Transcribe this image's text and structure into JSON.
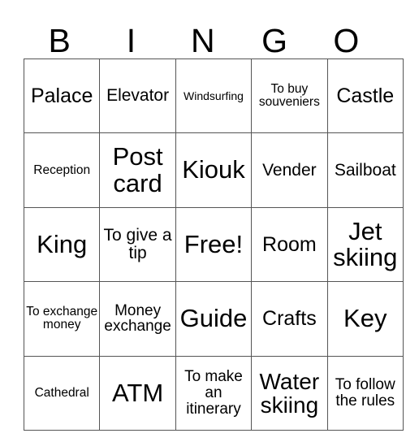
{
  "card": {
    "title_letters": [
      "B",
      "I",
      "N",
      "G",
      "O"
    ],
    "free_space_label": "Free!",
    "colors": {
      "background": "#ffffff",
      "text": "#000000",
      "grid_line": "#555555"
    },
    "rows": [
      [
        {
          "label": "Palace",
          "size": "fs-lg"
        },
        {
          "label": "Elevator",
          "size": "fs-md"
        },
        {
          "label": "Windsurfing",
          "size": "fs-xxs"
        },
        {
          "label": "To buy souveniers",
          "size": "fs-xs"
        },
        {
          "label": "Castle",
          "size": "fs-lg"
        }
      ],
      [
        {
          "label": "Reception",
          "size": "fs-xs"
        },
        {
          "label": "Post card",
          "size": "fs-xxl"
        },
        {
          "label": "Kiouk",
          "size": "fs-xxl"
        },
        {
          "label": "Vender",
          "size": "fs-md"
        },
        {
          "label": "Sailboat",
          "size": "fs-md"
        }
      ],
      [
        {
          "label": "King",
          "size": "fs-xxl"
        },
        {
          "label": "To give a tip",
          "size": "fs-md"
        },
        {
          "label": "Free!",
          "size": "fs-xxl"
        },
        {
          "label": "Room",
          "size": "fs-lg"
        },
        {
          "label": "Jet skiing",
          "size": "fs-xxl"
        }
      ],
      [
        {
          "label": "To exchange money",
          "size": "fs-xs"
        },
        {
          "label": "Money exchange",
          "size": "fs-sm"
        },
        {
          "label": "Guide",
          "size": "fs-xxl"
        },
        {
          "label": "Crafts",
          "size": "fs-lg"
        },
        {
          "label": "Key",
          "size": "fs-xxl"
        }
      ],
      [
        {
          "label": "Cathedral",
          "size": "fs-xs"
        },
        {
          "label": "ATM",
          "size": "fs-xxl"
        },
        {
          "label": "To make an itinerary",
          "size": "fs-sm"
        },
        {
          "label": "Water skiing",
          "size": "fs-xl"
        },
        {
          "label": "To follow the rules",
          "size": "fs-sm"
        }
      ]
    ]
  }
}
